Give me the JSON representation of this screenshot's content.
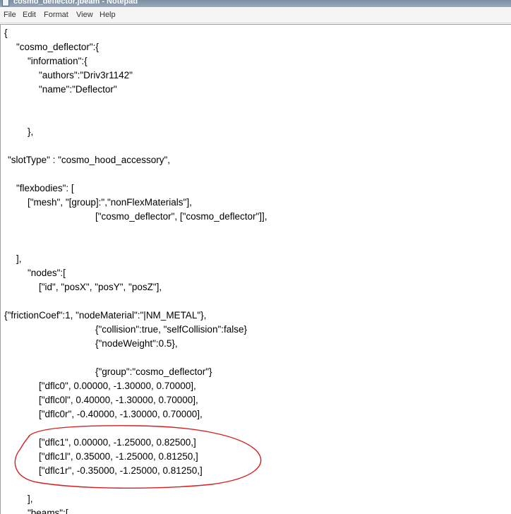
{
  "window": {
    "title": "cosmo_deflector.jbeam - Notepad"
  },
  "menu": {
    "file": "File",
    "edit": "Edit",
    "format": "Format",
    "view": "View",
    "help": "Help"
  },
  "editor": {
    "lines": [
      "{",
      "\"cosmo_deflector\":{",
      "\"information\":{",
      "\"authors\":\"Driv3r1142\"",
      "\"name\":\"Deflector\"",
      "},",
      "\"slotType\" : \"cosmo_hood_accessory\",",
      "\"flexbodies\": [",
      "[\"mesh\", \"[group]:\",\"nonFlexMaterials\"],",
      "[\"cosmo_deflector\", [\"cosmo_deflector\"]],",
      "],",
      "\"nodes\":[",
      "[\"id\", \"posX\", \"posY\", \"posZ\"],",
      "{\"frictionCoef\":1, \"nodeMaterial\":\"|NM_METAL\"},",
      "{\"collision\":true, \"selfCollision\":false}",
      "{\"nodeWeight\":0.5},",
      "{\"group\":\"cosmo_deflector\"}",
      "[\"dflc0\", 0.00000, -1.30000, 0.70000],",
      "[\"dflc0l\", 0.40000, -1.30000, 0.70000],",
      "[\"dflc0r\", -0.40000, -1.30000, 0.70000],",
      "[\"dflc1\", 0.00000, -1.25000, 0.82500,]",
      "[\"dflc1l\", 0.35000, -1.25000, 0.81250,]",
      "[\"dflc1r\", -0.35000, -1.25000, 0.81250,]",
      "],",
      "\"beams\":["
    ]
  },
  "colors": {
    "annotation": "#d42020",
    "titlebar": "#8a9db0",
    "menubar": "#f5f5f5"
  }
}
